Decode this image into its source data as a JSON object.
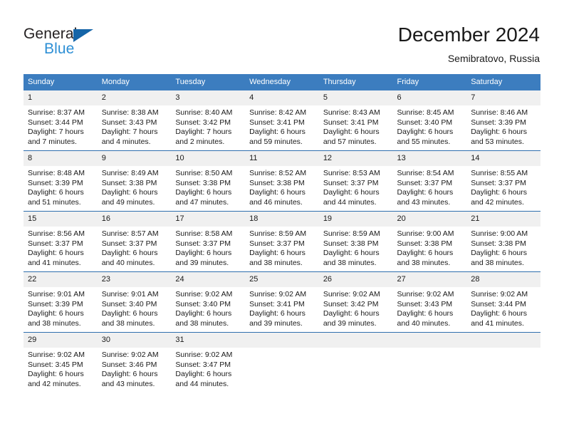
{
  "brand": {
    "name_top": "General",
    "name_bottom": "Blue",
    "triangle_icon": "triangle-icon",
    "color_dark": "#231f20",
    "color_blue": "#2d8fd5",
    "color_triangle": "#1565a8"
  },
  "header": {
    "title": "December 2024",
    "subtitle": "Semibratovo, Russia"
  },
  "theme": {
    "header_blue": "#3c7dbf",
    "row_divider_blue": "#2f6fae",
    "daynum_band": "#f0f0f0",
    "text": "#1a1a1a"
  },
  "calendar": {
    "weekday_headers": [
      "Sunday",
      "Monday",
      "Tuesday",
      "Wednesday",
      "Thursday",
      "Friday",
      "Saturday"
    ],
    "weeks": [
      [
        {
          "day": "1",
          "sunrise": "Sunrise: 8:37 AM",
          "sunset": "Sunset: 3:44 PM",
          "daylight_line1": "Daylight: 7 hours",
          "daylight_line2": "and 7 minutes."
        },
        {
          "day": "2",
          "sunrise": "Sunrise: 8:38 AM",
          "sunset": "Sunset: 3:43 PM",
          "daylight_line1": "Daylight: 7 hours",
          "daylight_line2": "and 4 minutes."
        },
        {
          "day": "3",
          "sunrise": "Sunrise: 8:40 AM",
          "sunset": "Sunset: 3:42 PM",
          "daylight_line1": "Daylight: 7 hours",
          "daylight_line2": "and 2 minutes."
        },
        {
          "day": "4",
          "sunrise": "Sunrise: 8:42 AM",
          "sunset": "Sunset: 3:41 PM",
          "daylight_line1": "Daylight: 6 hours",
          "daylight_line2": "and 59 minutes."
        },
        {
          "day": "5",
          "sunrise": "Sunrise: 8:43 AM",
          "sunset": "Sunset: 3:41 PM",
          "daylight_line1": "Daylight: 6 hours",
          "daylight_line2": "and 57 minutes."
        },
        {
          "day": "6",
          "sunrise": "Sunrise: 8:45 AM",
          "sunset": "Sunset: 3:40 PM",
          "daylight_line1": "Daylight: 6 hours",
          "daylight_line2": "and 55 minutes."
        },
        {
          "day": "7",
          "sunrise": "Sunrise: 8:46 AM",
          "sunset": "Sunset: 3:39 PM",
          "daylight_line1": "Daylight: 6 hours",
          "daylight_line2": "and 53 minutes."
        }
      ],
      [
        {
          "day": "8",
          "sunrise": "Sunrise: 8:48 AM",
          "sunset": "Sunset: 3:39 PM",
          "daylight_line1": "Daylight: 6 hours",
          "daylight_line2": "and 51 minutes."
        },
        {
          "day": "9",
          "sunrise": "Sunrise: 8:49 AM",
          "sunset": "Sunset: 3:38 PM",
          "daylight_line1": "Daylight: 6 hours",
          "daylight_line2": "and 49 minutes."
        },
        {
          "day": "10",
          "sunrise": "Sunrise: 8:50 AM",
          "sunset": "Sunset: 3:38 PM",
          "daylight_line1": "Daylight: 6 hours",
          "daylight_line2": "and 47 minutes."
        },
        {
          "day": "11",
          "sunrise": "Sunrise: 8:52 AM",
          "sunset": "Sunset: 3:38 PM",
          "daylight_line1": "Daylight: 6 hours",
          "daylight_line2": "and 46 minutes."
        },
        {
          "day": "12",
          "sunrise": "Sunrise: 8:53 AM",
          "sunset": "Sunset: 3:37 PM",
          "daylight_line1": "Daylight: 6 hours",
          "daylight_line2": "and 44 minutes."
        },
        {
          "day": "13",
          "sunrise": "Sunrise: 8:54 AM",
          "sunset": "Sunset: 3:37 PM",
          "daylight_line1": "Daylight: 6 hours",
          "daylight_line2": "and 43 minutes."
        },
        {
          "day": "14",
          "sunrise": "Sunrise: 8:55 AM",
          "sunset": "Sunset: 3:37 PM",
          "daylight_line1": "Daylight: 6 hours",
          "daylight_line2": "and 42 minutes."
        }
      ],
      [
        {
          "day": "15",
          "sunrise": "Sunrise: 8:56 AM",
          "sunset": "Sunset: 3:37 PM",
          "daylight_line1": "Daylight: 6 hours",
          "daylight_line2": "and 41 minutes."
        },
        {
          "day": "16",
          "sunrise": "Sunrise: 8:57 AM",
          "sunset": "Sunset: 3:37 PM",
          "daylight_line1": "Daylight: 6 hours",
          "daylight_line2": "and 40 minutes."
        },
        {
          "day": "17",
          "sunrise": "Sunrise: 8:58 AM",
          "sunset": "Sunset: 3:37 PM",
          "daylight_line1": "Daylight: 6 hours",
          "daylight_line2": "and 39 minutes."
        },
        {
          "day": "18",
          "sunrise": "Sunrise: 8:59 AM",
          "sunset": "Sunset: 3:37 PM",
          "daylight_line1": "Daylight: 6 hours",
          "daylight_line2": "and 38 minutes."
        },
        {
          "day": "19",
          "sunrise": "Sunrise: 8:59 AM",
          "sunset": "Sunset: 3:38 PM",
          "daylight_line1": "Daylight: 6 hours",
          "daylight_line2": "and 38 minutes."
        },
        {
          "day": "20",
          "sunrise": "Sunrise: 9:00 AM",
          "sunset": "Sunset: 3:38 PM",
          "daylight_line1": "Daylight: 6 hours",
          "daylight_line2": "and 38 minutes."
        },
        {
          "day": "21",
          "sunrise": "Sunrise: 9:00 AM",
          "sunset": "Sunset: 3:38 PM",
          "daylight_line1": "Daylight: 6 hours",
          "daylight_line2": "and 38 minutes."
        }
      ],
      [
        {
          "day": "22",
          "sunrise": "Sunrise: 9:01 AM",
          "sunset": "Sunset: 3:39 PM",
          "daylight_line1": "Daylight: 6 hours",
          "daylight_line2": "and 38 minutes."
        },
        {
          "day": "23",
          "sunrise": "Sunrise: 9:01 AM",
          "sunset": "Sunset: 3:40 PM",
          "daylight_line1": "Daylight: 6 hours",
          "daylight_line2": "and 38 minutes."
        },
        {
          "day": "24",
          "sunrise": "Sunrise: 9:02 AM",
          "sunset": "Sunset: 3:40 PM",
          "daylight_line1": "Daylight: 6 hours",
          "daylight_line2": "and 38 minutes."
        },
        {
          "day": "25",
          "sunrise": "Sunrise: 9:02 AM",
          "sunset": "Sunset: 3:41 PM",
          "daylight_line1": "Daylight: 6 hours",
          "daylight_line2": "and 39 minutes."
        },
        {
          "day": "26",
          "sunrise": "Sunrise: 9:02 AM",
          "sunset": "Sunset: 3:42 PM",
          "daylight_line1": "Daylight: 6 hours",
          "daylight_line2": "and 39 minutes."
        },
        {
          "day": "27",
          "sunrise": "Sunrise: 9:02 AM",
          "sunset": "Sunset: 3:43 PM",
          "daylight_line1": "Daylight: 6 hours",
          "daylight_line2": "and 40 minutes."
        },
        {
          "day": "28",
          "sunrise": "Sunrise: 9:02 AM",
          "sunset": "Sunset: 3:44 PM",
          "daylight_line1": "Daylight: 6 hours",
          "daylight_line2": "and 41 minutes."
        }
      ],
      [
        {
          "day": "29",
          "sunrise": "Sunrise: 9:02 AM",
          "sunset": "Sunset: 3:45 PM",
          "daylight_line1": "Daylight: 6 hours",
          "daylight_line2": "and 42 minutes."
        },
        {
          "day": "30",
          "sunrise": "Sunrise: 9:02 AM",
          "sunset": "Sunset: 3:46 PM",
          "daylight_line1": "Daylight: 6 hours",
          "daylight_line2": "and 43 minutes."
        },
        {
          "day": "31",
          "sunrise": "Sunrise: 9:02 AM",
          "sunset": "Sunset: 3:47 PM",
          "daylight_line1": "Daylight: 6 hours",
          "daylight_line2": "and 44 minutes."
        },
        {
          "day": "",
          "sunrise": "",
          "sunset": "",
          "daylight_line1": "",
          "daylight_line2": ""
        },
        {
          "day": "",
          "sunrise": "",
          "sunset": "",
          "daylight_line1": "",
          "daylight_line2": ""
        },
        {
          "day": "",
          "sunrise": "",
          "sunset": "",
          "daylight_line1": "",
          "daylight_line2": ""
        },
        {
          "day": "",
          "sunrise": "",
          "sunset": "",
          "daylight_line1": "",
          "daylight_line2": ""
        }
      ]
    ]
  }
}
